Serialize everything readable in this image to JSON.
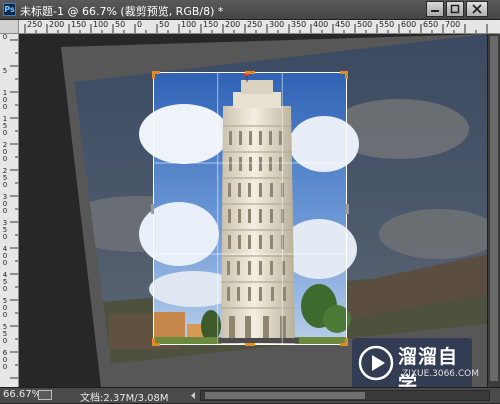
{
  "titlebar": {
    "app_icon": "Ps",
    "document_title": "未标题-1 @ 66.7% (裁剪预览, RGB/8) *"
  },
  "window_controls": {
    "minimize_icon": "minimize-icon",
    "maximize_icon": "maximize-icon",
    "close_icon": "close-icon"
  },
  "ruler_top": {
    "labels": [
      "250",
      "200",
      "150",
      "100",
      "50",
      "0",
      "50",
      "100",
      "150",
      "200",
      "250",
      "300",
      "350",
      "400",
      "450",
      "500",
      "550",
      "600",
      "650",
      "700"
    ]
  },
  "ruler_left": {
    "labels": [
      "0",
      "5",
      "100",
      "150",
      "200",
      "250",
      "300",
      "350",
      "400",
      "450",
      "500",
      "550",
      "600"
    ]
  },
  "statusbar": {
    "zoom": "66.67%",
    "doc_info": "文档:2.37M/3.08M"
  },
  "watermark": {
    "name": "溜溜自学",
    "url": "ZIXUE.3066.COM"
  },
  "colors": {
    "workspace": "#282828",
    "titlebar": "#4f4f4f",
    "ruler": "#e6e6e6",
    "crop_frame": "#ffffff",
    "crop_handle": "#e08a2a",
    "sky": "#4a7cc0",
    "tower": "#ece6d6"
  }
}
